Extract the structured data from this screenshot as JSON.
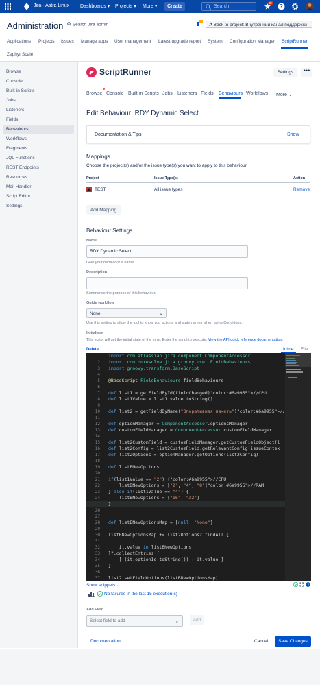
{
  "topbar": {
    "product": "Jira - Astra Linux",
    "menus": [
      "Dashboards",
      "Projects",
      "More"
    ],
    "create": "Create",
    "search_placeholder": "Search",
    "notifications_count": "3+"
  },
  "admin": {
    "title": "Administration",
    "search": "Search Jira admin",
    "back": "Back to project: Внутренний канал поддержки",
    "tabs": [
      "Applications",
      "Projects",
      "Issues",
      "Manage apps",
      "User management",
      "Latest upgrade report",
      "System",
      "Configuration Manager",
      "ScriptRunner",
      "Zephyr Scale"
    ]
  },
  "sidebar": {
    "items": [
      "Browse",
      "Console",
      "Built-in Scripts",
      "Jobs",
      "Listeners",
      "Fields",
      "Behaviours",
      "Workflows",
      "Fragments",
      "JQL Functions",
      "REST Endpoints",
      "Resources",
      "Mail Handler",
      "Script Editor",
      "Settings"
    ]
  },
  "sr": {
    "logo": "ScriptRunner",
    "settings": "Settings",
    "more_dots": "•••",
    "tabs": [
      "Browse",
      "Console",
      "Built-in Scripts",
      "Jobs",
      "Listeners",
      "Fields",
      "Behaviours",
      "Workflows",
      "More"
    ]
  },
  "edit": {
    "title": "Edit Behaviour: RDY Dynamic Select",
    "doc_tips": "Documentation & Tips",
    "show": "Show"
  },
  "mappings": {
    "title": "Mappings",
    "desc": "Choose the project(s) and/or the issue type(s) you want to apply to this behaviour.",
    "headers": [
      "Project",
      "Issue Type(s)",
      "Action"
    ],
    "rows": [
      {
        "project": "TEST",
        "issue_types": "All issue types",
        "action": "Remove"
      }
    ],
    "add": "Add Mapping"
  },
  "settings": {
    "title": "Behaviour Settings",
    "name_label": "Name",
    "name_value": "RDY Dynamic Select",
    "name_help": "Give your behaviour a name.",
    "desc_label": "Description",
    "desc_help": "Summarise the purpose of this behaviour.",
    "wf_label": "Guide workflow",
    "wf_value": "None",
    "wf_help": "Use this setting to allow the tool to show you actions and state names when using Conditions.",
    "init_label": "Initialiser",
    "init_help_pre": "This script will set the initial state of the form. Enter the script to execute.",
    "init_help_link": "View the API quick reference documentation.",
    "delete": "Delete",
    "inline": "Inline",
    "file": "File"
  },
  "code": {
    "lines": [
      {
        "n": "1",
        "t": "import com.atlassian.jira.component.ComponentAccessor"
      },
      {
        "n": "2",
        "t": "import com.onresolve.jira.groovy.user.FieldBehaviours"
      },
      {
        "n": "3",
        "t": "import groovy.transform.BaseScript"
      },
      {
        "n": "4",
        "t": ""
      },
      {
        "n": "5",
        "t": "@BaseScript FieldBehaviours fieldBehaviours"
      },
      {
        "n": "6",
        "t": ""
      },
      {
        "n": "7",
        "t": "def list1 = getFieldById(fieldChanged)//CPU"
      },
      {
        "n": "8",
        "t": "def list1Value = list1.value.toString()"
      },
      {
        "n": "9",
        "t": ""
      },
      {
        "n": "10",
        "t": "def list2 = getFieldByName(\"Оперативная память\")//RAM"
      },
      {
        "n": "11",
        "t": ""
      },
      {
        "n": "12",
        "t": "def optionManager = ComponentAccessor.optionsManager"
      },
      {
        "n": "13",
        "t": "def customFieldManager = ComponentAccessor.customFieldManager"
      },
      {
        "n": "14",
        "t": ""
      },
      {
        "n": "15",
        "t": "def list2CustomField = customFieldManager.getCustomFieldObject(l"
      },
      {
        "n": "16",
        "t": "def list2Config = list2CustomField.getRelevantConfig(issueContex"
      },
      {
        "n": "17",
        "t": "def list2Options = optionManager.getOptions(list2Config)"
      },
      {
        "n": "18",
        "t": ""
      },
      {
        "n": "19",
        "t": "def listBNewOptions"
      },
      {
        "n": "20",
        "t": ""
      },
      {
        "n": "21",
        "t": "if(list1Value == \"2\") {//CPU"
      },
      {
        "n": "22",
        "t": "    listBNewOptions = [\"2\", \"4\", \"8\"]//RAM"
      },
      {
        "n": "23",
        "t": "} else if(list1Value == \"4\") {"
      },
      {
        "n": "24",
        "t": "    listBNewOptions = [\"16\", \"32\"]"
      },
      {
        "n": "25",
        "t": "}"
      },
      {
        "n": "26",
        "t": ""
      },
      {
        "n": "27",
        "t": ""
      },
      {
        "n": "28",
        "t": "def listBNewOptionsMap = [null: \"None\"]"
      },
      {
        "n": "29",
        "t": ""
      },
      {
        "n": "30",
        "t": "listBNewOptionsMap += list2Options?.findAll {"
      },
      {
        "n": "31",
        "t": ""
      },
      {
        "n": "32",
        "t": "    it.value in listBNewOptions"
      },
      {
        "n": "33",
        "t": "}?.collectEntries {"
      },
      {
        "n": "34",
        "t": "    [ (it.optionId.toString()) : it.value ]"
      },
      {
        "n": "35",
        "t": "}"
      },
      {
        "n": "36",
        "t": ""
      },
      {
        "n": "37",
        "t": "list2.setFieldOptions(listBNewOptionsMap)"
      }
    ]
  },
  "footer": {
    "snippets": "Show snippets",
    "status": "No failures in the last 15 execution(s)",
    "add_field_label": "Add Field",
    "add_field_placeholder": "Select field to add",
    "add": "Add",
    "documentation": "Documentation",
    "cancel": "Cancel",
    "save": "Save Changes"
  },
  "colors": {
    "topbar": "#0747a6",
    "primary": "#0052cc",
    "code_bg": "#1e1e1e",
    "success": "#36b37e"
  }
}
